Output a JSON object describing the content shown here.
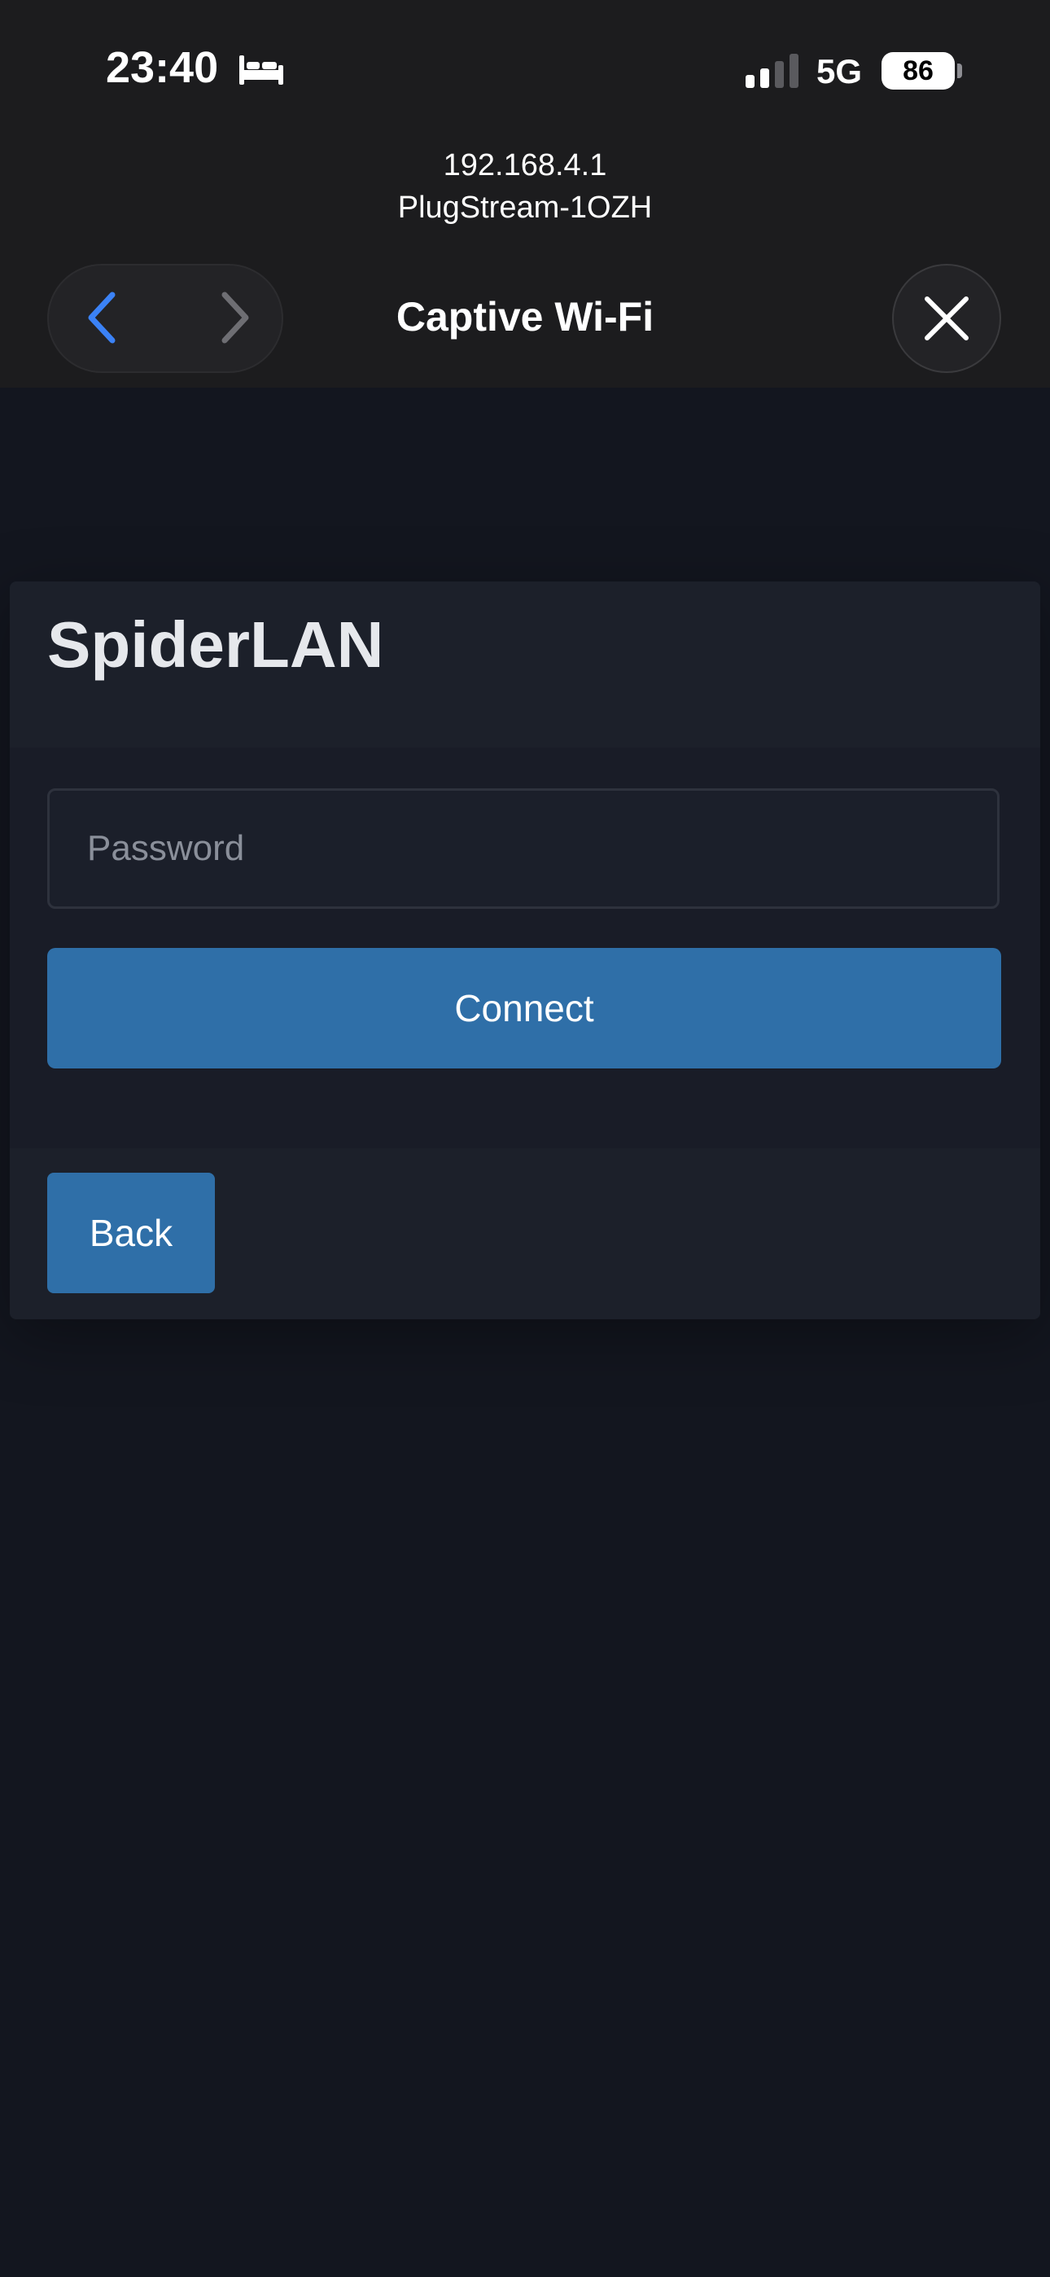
{
  "status_bar": {
    "time": "23:40",
    "focus_icon": "bed-icon",
    "signal_icon": "cellular-signal-icon",
    "network": "5G",
    "battery": "86"
  },
  "header": {
    "ip": "192.168.4.1",
    "ssid": "PlugStream-1OZH",
    "title": "Captive Wi-Fi",
    "back_icon": "chevron-left-icon",
    "forward_icon": "chevron-right-icon",
    "close_icon": "close-icon"
  },
  "card": {
    "title": "SpiderLAN",
    "password_placeholder": "Password",
    "connect_label": "Connect",
    "back_label": "Back"
  },
  "colors": {
    "accent": "#2f6fa8",
    "nav_active": "#3b82f6",
    "background": "#13161f"
  }
}
